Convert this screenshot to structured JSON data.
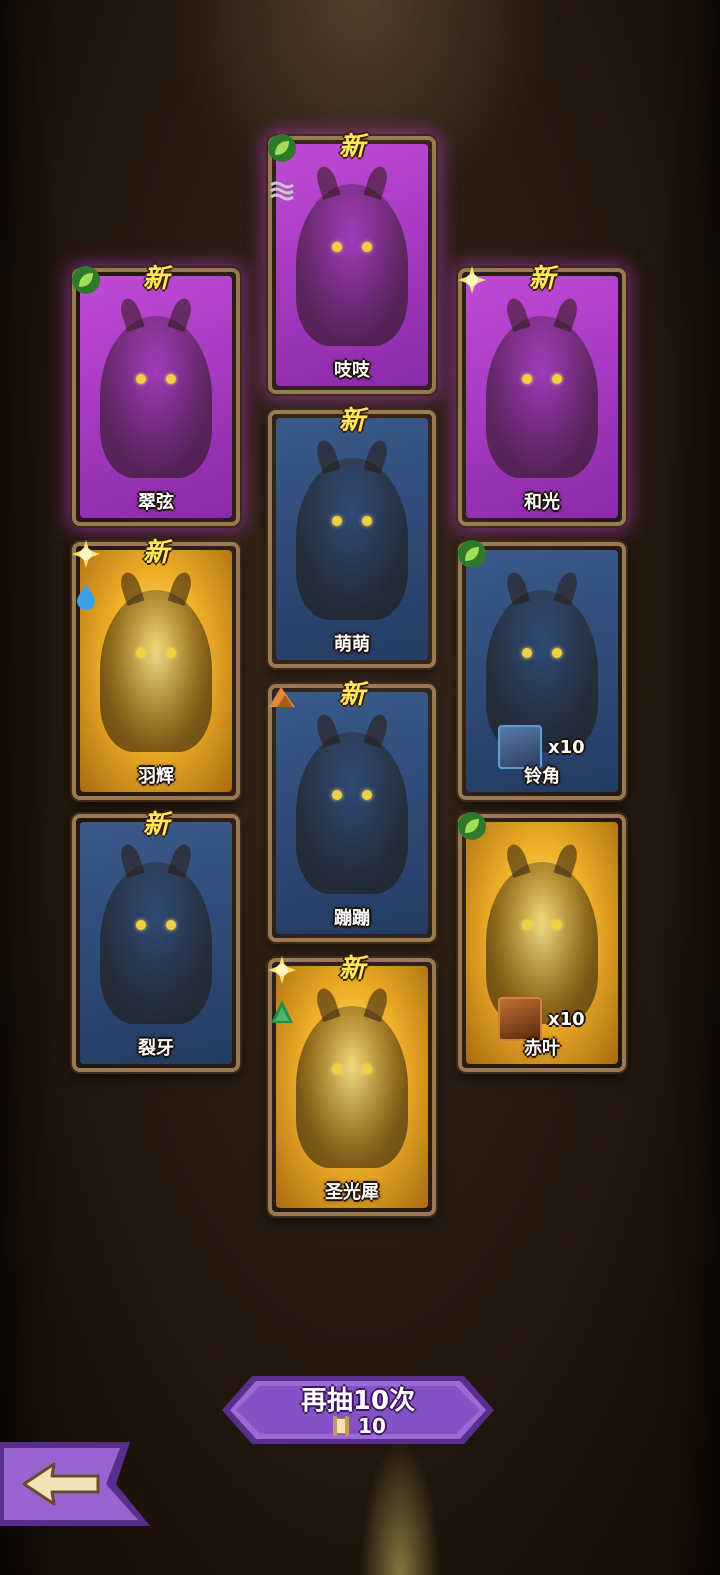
{
  "new_label": "新",
  "cards": [
    {
      "name": "吱吱",
      "rarity": "epic",
      "is_new": true,
      "elements": [
        "leaf",
        "water-wave"
      ],
      "duplicate": null
    },
    {
      "name": "翠弦",
      "rarity": "epic",
      "is_new": true,
      "elements": [
        "leaf"
      ],
      "duplicate": null
    },
    {
      "name": "和光",
      "rarity": "epic",
      "is_new": true,
      "elements": [
        "sun"
      ],
      "duplicate": null
    },
    {
      "name": "萌萌",
      "rarity": "rare",
      "is_new": true,
      "elements": [],
      "duplicate": null
    },
    {
      "name": "羽辉",
      "rarity": "legend",
      "is_new": true,
      "elements": [
        "sun",
        "water-drop"
      ],
      "duplicate": null
    },
    {
      "name": "铃角",
      "rarity": "rare",
      "is_new": false,
      "elements": [
        "leaf"
      ],
      "duplicate": {
        "count_label": "x10"
      }
    },
    {
      "name": "蹦蹦",
      "rarity": "rare",
      "is_new": true,
      "elements": [
        "mountain"
      ],
      "duplicate": null
    },
    {
      "name": "裂牙",
      "rarity": "rare",
      "is_new": true,
      "elements": [],
      "duplicate": null
    },
    {
      "name": "赤叶",
      "rarity": "legend",
      "is_new": false,
      "elements": [
        "leaf"
      ],
      "duplicate": {
        "count_label": "x10"
      }
    },
    {
      "name": "圣光犀",
      "rarity": "legend",
      "is_new": true,
      "elements": [
        "sun",
        "tree"
      ],
      "duplicate": null
    }
  ],
  "redraw_button": {
    "label": "再抽10次",
    "cost": "10",
    "cost_icon": "scroll-icon"
  },
  "back_button": {
    "icon": "back-arrow-icon"
  },
  "colors": {
    "epic": "#b23fd0",
    "rare": "#2f4a78",
    "legend": "#f0b028",
    "frame": "#9a7a52",
    "button": "#8a5cc8"
  }
}
